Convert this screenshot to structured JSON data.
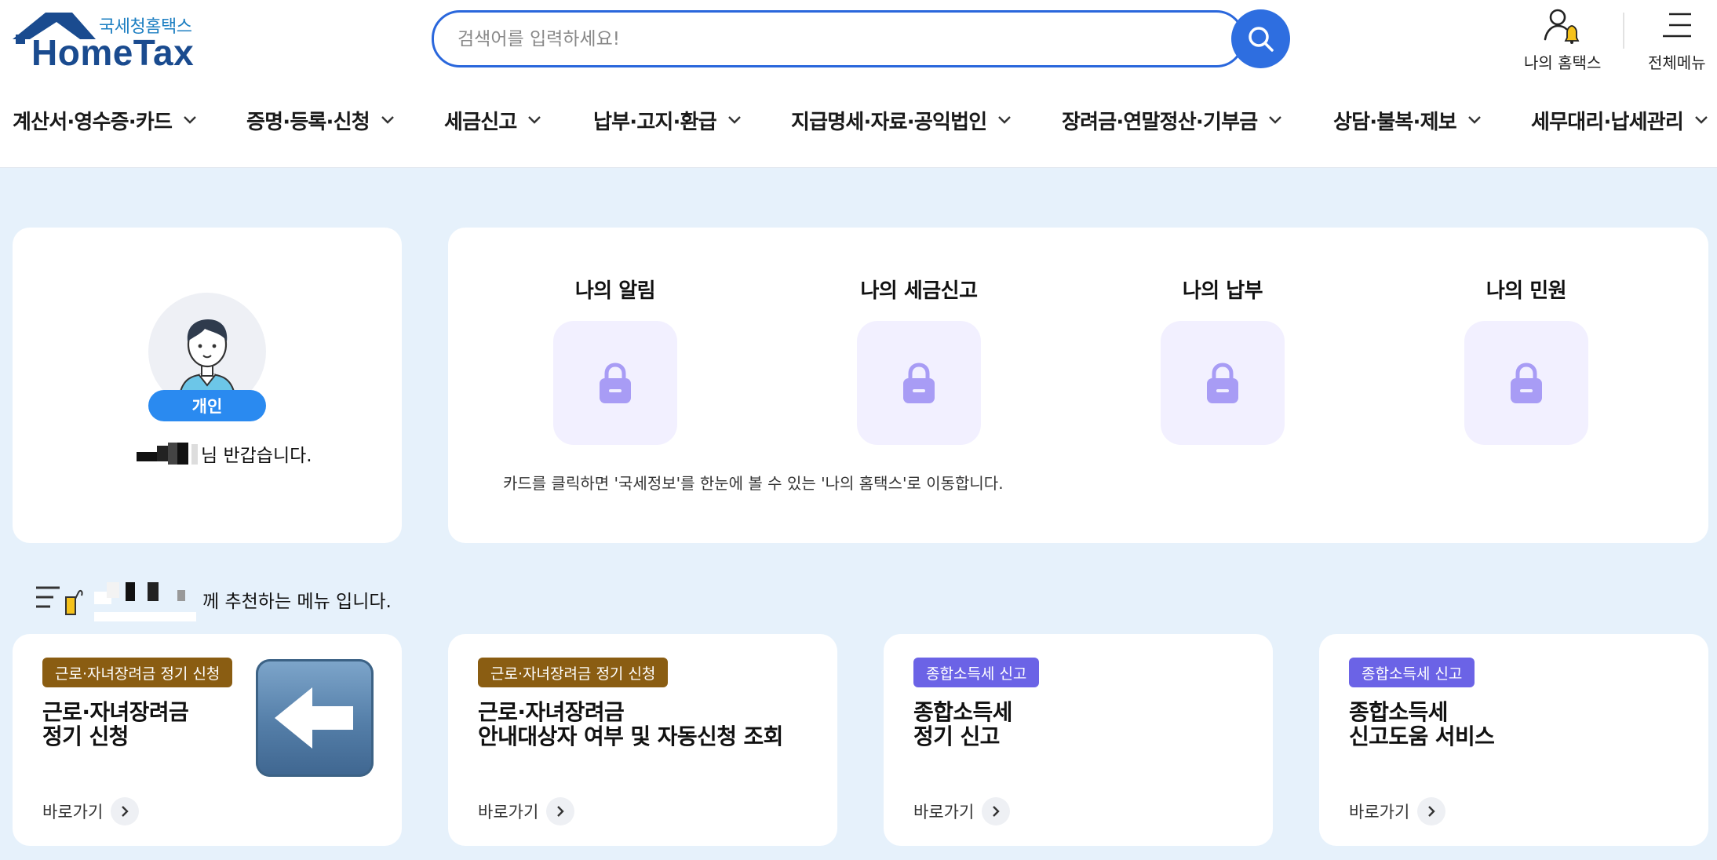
{
  "header": {
    "logo_sub": "국세청홈택스",
    "logo_main": "HomeTax",
    "search": {
      "placeholder": "검색어를 입력하세요!"
    },
    "my_hometax_label": "나의 홈택스",
    "all_menu_label": "전체메뉴"
  },
  "nav": {
    "items": [
      {
        "label": "계산서·영수증·카드"
      },
      {
        "label": "증명·등록·신청"
      },
      {
        "label": "세금신고"
      },
      {
        "label": "납부·고지·환급"
      },
      {
        "label": "지급명세·자료·공익법인"
      },
      {
        "label": "장려금·연말정산·기부금"
      },
      {
        "label": "상담·불복·제보"
      },
      {
        "label": "세무대리·납세관리"
      }
    ]
  },
  "profile": {
    "badge": "개인",
    "greeting_suffix": "님 반갑습니다."
  },
  "mine": {
    "items": [
      {
        "title": "나의 알림",
        "icon": "lock-icon"
      },
      {
        "title": "나의 세금신고",
        "icon": "lock-icon"
      },
      {
        "title": "나의 납부",
        "icon": "lock-icon"
      },
      {
        "title": "나의 민원",
        "icon": "lock-icon"
      }
    ],
    "note": "카드를 클릭하면 '국세정보'를 한눈에 볼 수 있는 '나의 홈택스'로 이동합니다."
  },
  "recommend": {
    "title_suffix": "께 추천하는 메뉴 입니다.",
    "cards": [
      {
        "tag": "근로·자녀장려금 정기 신청",
        "tag_color": "#8a5d12",
        "name_line1": "근로·자녀장려금",
        "name_line2": "정기 신청",
        "go": "바로가기",
        "icon": "left-arrow-emoji-icon"
      },
      {
        "tag": "근로·자녀장려금 정기 신청",
        "tag_color": "#8a5d12",
        "name_line1": "근로·자녀장려금",
        "name_line2": "안내대상자 여부 및 자동신청 조회",
        "go": "바로가기"
      },
      {
        "tag": "종합소득세 신고",
        "tag_color": "#6b63e6",
        "name_line1": "종합소득세",
        "name_line2": "정기 신고",
        "go": "바로가기"
      },
      {
        "tag": "종합소득세 신고",
        "tag_color": "#6b63e6",
        "name_line1": "종합소득세",
        "name_line2": "신고도움 서비스",
        "go": "바로가기"
      }
    ]
  },
  "colors": {
    "accent_blue": "#2e6ee0",
    "page_bg": "#e6f1fb",
    "lock_purple": "#a89cf5",
    "tile_bg": "#f2f0ff"
  }
}
